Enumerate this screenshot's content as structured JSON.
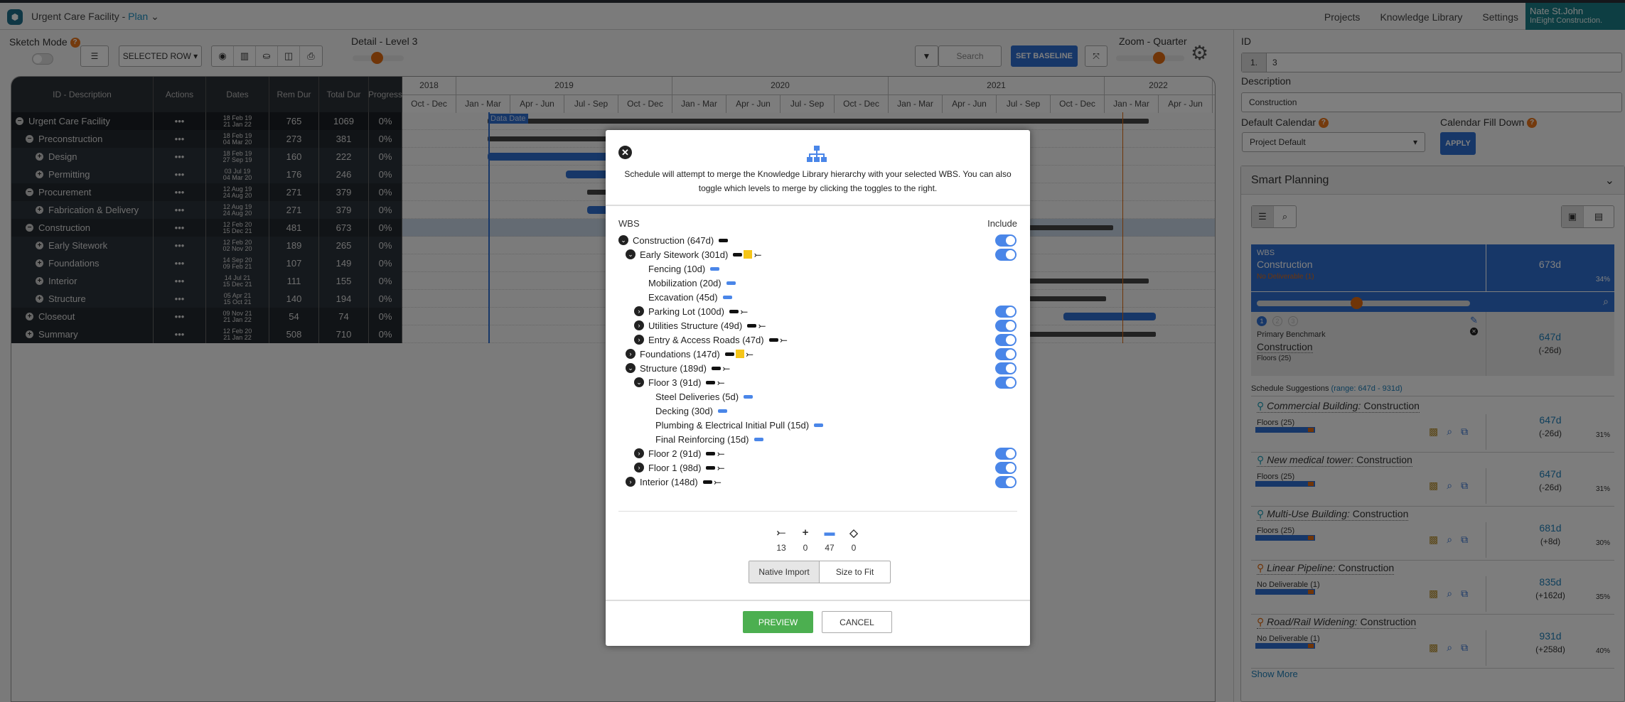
{
  "header": {
    "app_title": "Urgent Care Facility - ",
    "plan_label": "Plan",
    "nav": [
      "Projects",
      "Knowledge Library",
      "Settings"
    ],
    "user_name": "Nate St.John",
    "user_org": "InEight Construction."
  },
  "toolbar": {
    "sketch_mode": "Sketch Mode",
    "selected_row": "SELECTED ROW",
    "detail_label": "Detail - Level 3",
    "detail_level": 3,
    "search_placeholder": "Search",
    "set_baseline": "SET BASELINE",
    "zoom_label": "Zoom - Quarter",
    "zoom_level": "Quarter"
  },
  "grid": {
    "columns": [
      "ID - Description",
      "Actions",
      "Dates",
      "Rem Dur",
      "Total Dur",
      "Progress"
    ],
    "years": [
      "2018",
      "2019",
      "2020",
      "2021",
      "2022"
    ],
    "quarters": [
      "Oct - Dec",
      "Jan - Mar",
      "Apr - Jun",
      "Jul - Sep",
      "Oct - Dec",
      "Jan - Mar",
      "Apr - Jun",
      "Jul - Sep",
      "Oct - Dec",
      "Jan - Mar",
      "Apr - Jun",
      "Jul - Sep",
      "Oct - Dec",
      "Jan - Mar",
      "Apr - Jun"
    ],
    "data_date_label": "Data Date",
    "actions_glyph": "•••",
    "rows": [
      {
        "name": "Urgent Care Facility",
        "level": 0,
        "toggle": "−",
        "start": "18 Feb 19",
        "end": "21 Jan 22",
        "rem": "765",
        "total": "1069",
        "progress": "0%"
      },
      {
        "name": "Preconstruction",
        "level": 1,
        "toggle": "−",
        "start": "18 Feb 19",
        "end": "04 Mar 20",
        "rem": "273",
        "total": "381",
        "progress": "0%"
      },
      {
        "name": "Design",
        "level": 2,
        "toggle": "+",
        "start": "18 Feb 19",
        "end": "27 Sep 19",
        "rem": "160",
        "total": "222",
        "progress": "0%"
      },
      {
        "name": "Permitting",
        "level": 2,
        "toggle": "+",
        "start": "03 Jul 19",
        "end": "04 Mar 20",
        "rem": "176",
        "total": "246",
        "progress": "0%"
      },
      {
        "name": "Procurement",
        "level": 1,
        "toggle": "−",
        "start": "12 Aug 19",
        "end": "24 Aug 20",
        "rem": "271",
        "total": "379",
        "progress": "0%"
      },
      {
        "name": "Fabrication & Delivery",
        "level": 2,
        "toggle": "+",
        "start": "12 Aug 19",
        "end": "24 Aug 20",
        "rem": "271",
        "total": "379",
        "progress": "0%"
      },
      {
        "name": "Construction",
        "level": 1,
        "toggle": "−",
        "start": "12 Feb 20",
        "end": "15 Dec 21",
        "rem": "481",
        "total": "673",
        "progress": "0%"
      },
      {
        "name": "Early Sitework",
        "level": 2,
        "toggle": "+",
        "start": "12 Feb 20",
        "end": "02 Nov 20",
        "rem": "189",
        "total": "265",
        "progress": "0%"
      },
      {
        "name": "Foundations",
        "level": 2,
        "toggle": "+",
        "start": "14 Sep 20",
        "end": "09 Feb 21",
        "rem": "107",
        "total": "149",
        "progress": "0%"
      },
      {
        "name": "Interior",
        "level": 2,
        "toggle": "+",
        "start": "14 Jul 21",
        "end": "15 Dec 21",
        "rem": "111",
        "total": "155",
        "progress": "0%"
      },
      {
        "name": "Structure",
        "level": 2,
        "toggle": "+",
        "start": "05 Apr 21",
        "end": "15 Oct 21",
        "rem": "140",
        "total": "194",
        "progress": "0%"
      },
      {
        "name": "Closeout",
        "level": 1,
        "toggle": "+",
        "start": "09 Nov 21",
        "end": "21 Jan 22",
        "rem": "54",
        "total": "74",
        "progress": "0%"
      },
      {
        "name": "Summary",
        "level": 1,
        "toggle": "+",
        "start": "12 Feb 20",
        "end": "21 Jan 22",
        "rem": "508",
        "total": "710",
        "progress": "0%"
      }
    ]
  },
  "details": {
    "id_label": "ID",
    "id_prefix": "1.",
    "id_value": "3",
    "description_label": "Description",
    "description_value": "Construction",
    "default_calendar_label": "Default Calendar",
    "default_calendar_value": "Project Default",
    "calendar_fill_label": "Calendar Fill Down",
    "apply": "APPLY"
  },
  "smart_planning": {
    "title": "Smart Planning",
    "wbs_label": "WBS",
    "wbs_name": "Construction",
    "wbs_note": "No Deliverable (1)",
    "wbs_duration": "673d",
    "wbs_pct": "34%",
    "steps": [
      "1",
      "2",
      "3"
    ],
    "benchmark_label": "Primary Benchmark",
    "benchmark_name": "Construction",
    "benchmark_sub": "Floors (25)",
    "benchmark_duration": "647d",
    "benchmark_delta": "(-26d)",
    "suggestions_label": "Schedule Suggestions",
    "suggestions_range": "(range: 647d - 931d)",
    "suggestions": [
      {
        "project": "Commercial Building:",
        "name": " Construction",
        "sub": "Floors (25)",
        "duration": "647d",
        "delta": "(-26d)",
        "pct": "31%",
        "pin": "teal"
      },
      {
        "project": "New medical tower:",
        "name": " Construction",
        "sub": "Floors (25)",
        "duration": "647d",
        "delta": "(-26d)",
        "pct": "31%",
        "pin": "teal"
      },
      {
        "project": "Multi-Use Building:",
        "name": " Construction",
        "sub": "Floors (25)",
        "duration": "681d",
        "delta": "(+8d)",
        "pct": "30%",
        "pin": "teal"
      },
      {
        "project": "Linear Pipeline:",
        "name": " Construction",
        "sub": "No Deliverable (1)",
        "duration": "835d",
        "delta": "(+162d)",
        "pct": "35%",
        "pin": "orange"
      },
      {
        "project": "Road/Rail Widening:",
        "name": " Construction",
        "sub": "No Deliverable (1)",
        "duration": "931d",
        "delta": "(+258d)",
        "pct": "40%",
        "pin": "orange"
      }
    ],
    "show_more": "Show More"
  },
  "modal": {
    "description": "Schedule will attempt to merge the Knowledge Library hierarchy with your selected WBS. You can also toggle which levels to merge by clicking the toggles to the right.",
    "wbs_label": "WBS",
    "include_label": "Include",
    "tree": [
      {
        "label": "Construction (647d)",
        "depth": 0,
        "chevron": "down",
        "icons": [
          "summary"
        ],
        "include": true
      },
      {
        "label": "Early Sitework (301d)",
        "depth": 1,
        "chevron": "down",
        "icons": [
          "summary",
          "note",
          "fork"
        ],
        "include": true
      },
      {
        "label": "Fencing (10d)",
        "depth": 3,
        "chevron": "none",
        "icons": [
          "task"
        ],
        "include": null
      },
      {
        "label": "Mobilization (20d)",
        "depth": 3,
        "chevron": "none",
        "icons": [
          "task"
        ],
        "include": null
      },
      {
        "label": "Excavation (45d)",
        "depth": 3,
        "chevron": "none",
        "icons": [
          "task"
        ],
        "include": null
      },
      {
        "label": "Parking Lot (100d)",
        "depth": 2,
        "chevron": "right",
        "icons": [
          "summary",
          "fork"
        ],
        "include": true
      },
      {
        "label": "Utilities Structure (49d)",
        "depth": 2,
        "chevron": "right",
        "icons": [
          "summary",
          "fork"
        ],
        "include": true
      },
      {
        "label": "Entry & Access Roads (47d)",
        "depth": 2,
        "chevron": "right",
        "icons": [
          "summary",
          "fork"
        ],
        "include": true
      },
      {
        "label": "Foundations (147d)",
        "depth": 1,
        "chevron": "right",
        "icons": [
          "summary",
          "note",
          "fork"
        ],
        "include": true
      },
      {
        "label": "Structure (189d)",
        "depth": 1,
        "chevron": "down",
        "icons": [
          "summary",
          "fork"
        ],
        "include": true
      },
      {
        "label": "Floor 3 (91d)",
        "depth": 2,
        "chevron": "down",
        "icons": [
          "summary",
          "fork"
        ],
        "include": true
      },
      {
        "label": "Steel Deliveries (5d)",
        "depth": 4,
        "chevron": "none",
        "icons": [
          "task"
        ],
        "include": null
      },
      {
        "label": "Decking (30d)",
        "depth": 4,
        "chevron": "none",
        "icons": [
          "task"
        ],
        "include": null
      },
      {
        "label": "Plumbing & Electrical Initial Pull (15d)",
        "depth": 4,
        "chevron": "none",
        "icons": [
          "task"
        ],
        "include": null
      },
      {
        "label": "Final Reinforcing (15d)",
        "depth": 4,
        "chevron": "none",
        "icons": [
          "task"
        ],
        "include": null
      },
      {
        "label": "Floor 2 (91d)",
        "depth": 2,
        "chevron": "right",
        "icons": [
          "summary",
          "fork"
        ],
        "include": true
      },
      {
        "label": "Floor 1 (98d)",
        "depth": 2,
        "chevron": "right",
        "icons": [
          "summary",
          "fork"
        ],
        "include": true
      },
      {
        "label": "Interior (148d)",
        "depth": 1,
        "chevron": "right",
        "icons": [
          "summary",
          "fork"
        ],
        "include": true
      }
    ],
    "stats": [
      {
        "icon": "fork-icon",
        "glyph": "⤚",
        "count": "13"
      },
      {
        "icon": "plus-icon",
        "glyph": "+",
        "count": "0"
      },
      {
        "icon": "task-bar-icon",
        "glyph": "▬",
        "count": "47"
      },
      {
        "icon": "milestone-icon",
        "glyph": "◇",
        "count": "0"
      }
    ],
    "mode_options": [
      "Native Import",
      "Size to Fit"
    ],
    "mode_selected": "Native Import",
    "preview": "PREVIEW",
    "cancel": "CANCEL"
  }
}
